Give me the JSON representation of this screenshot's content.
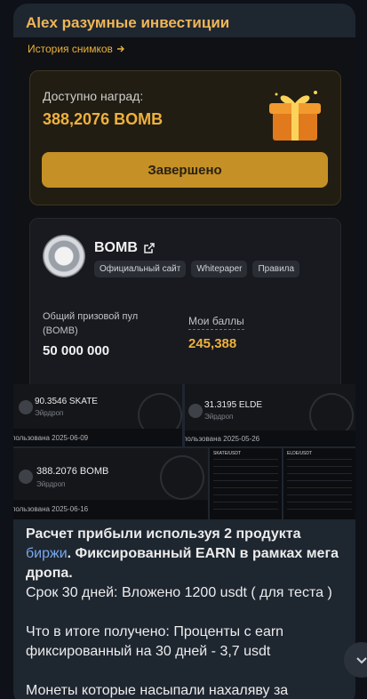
{
  "message": {
    "sender": "Alex разумные инвестиции"
  },
  "screenshot": {
    "history_link": "История снимков",
    "reward": {
      "label": "Доступно наград:",
      "value": "388,2076 BOMB",
      "button": "Завершено"
    },
    "token": {
      "name": "BOMB",
      "chips": [
        "Официальный сайт",
        "Whitepaper",
        "Правила"
      ],
      "pool_label": "Общий призовой пул (BOMB)",
      "pool_value": "50 000 000",
      "points_label": "Мои баллы",
      "points_value": "245,388"
    }
  },
  "thumbnails": [
    {
      "amount": "90.3546 SKATE",
      "sub": "Эйрдроп",
      "used": "пользована 2025-06-09"
    },
    {
      "amount": "31.3195 ELDE",
      "sub": "Эйрдроп",
      "used": "пользована 2025-05-26"
    },
    {
      "amount": "388.2076 BOMB",
      "sub": "Эйрдроп",
      "used": "пользована 2025-06-16"
    }
  ],
  "mini_tables": [
    {
      "title": "SKATE/USDT"
    },
    {
      "title": "ELDE/USDT"
    }
  ],
  "caption": {
    "line1_a": "Расчет прибыли используя 2 продукта ",
    "line1_link": "биржи",
    "line1_b": ". ",
    "line1_c": " Фиксированный EARN в рамках мега дропа.",
    "line2": "Срок 30 дней:  Вложено 1200 usdt ( для теста )",
    "line3": "Что в итоге получено: Проценты с earn фиксированный на 30 дней - 3,7 usdt",
    "line4": "Монеты которые насыпали нахаляву за"
  },
  "colors": {
    "accent": "#efb13c",
    "sender": "#f0b656",
    "link": "#79a8ea"
  },
  "icons": {
    "arrow": "arrow-right-icon",
    "external": "external-link-icon",
    "gift": "gift-icon",
    "scroll": "chevron-down-icon"
  }
}
